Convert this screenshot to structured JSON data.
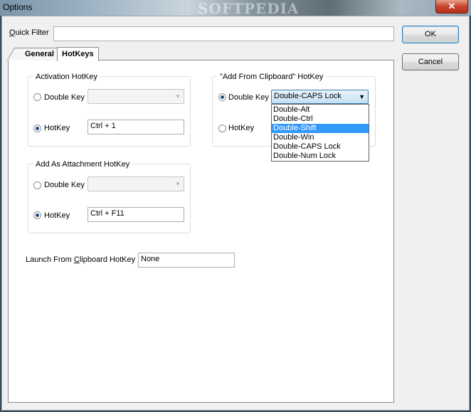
{
  "window": {
    "title": "Options",
    "watermark": "SOFTPEDIA",
    "close_glyph": "✕"
  },
  "quick_filter": {
    "label": "Quick Filter",
    "value": ""
  },
  "buttons": {
    "ok": "OK",
    "cancel": "Cancel"
  },
  "tabs": [
    {
      "label": "General"
    },
    {
      "label": "HotKeys"
    }
  ],
  "activation": {
    "title": "Activation HotKey",
    "double_key_label": "Double Key",
    "double_key_value": "",
    "hotkey_label": "HotKey",
    "hotkey_value": "Ctrl + 1"
  },
  "attachment": {
    "title": "Add As Attachment HotKey",
    "double_key_label": "Double Key",
    "double_key_value": "",
    "hotkey_label": "HotKey",
    "hotkey_value": "Ctrl + F11"
  },
  "clipboard": {
    "title": "\"Add From Clipboard\" HotKey",
    "double_key_label": "Double Key",
    "double_key_value": "Double-CAPS Lock",
    "hotkey_label": "HotKey",
    "options": [
      "Double-Alt",
      "Double-Ctrl",
      "Double-Shift",
      "Double-Win",
      "Double-CAPS Lock",
      "Double-Num Lock"
    ],
    "highlighted": "Double-Shift"
  },
  "launch": {
    "label_pre": "Launch From ",
    "label_u": "C",
    "label_post": "lipboard HotKey",
    "value": "None"
  }
}
